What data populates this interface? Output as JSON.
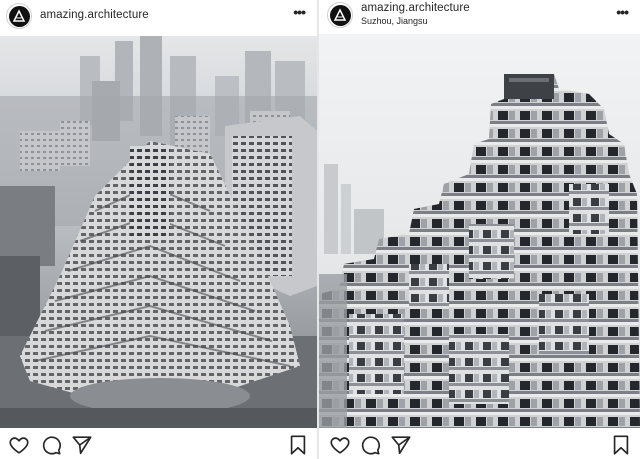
{
  "posts": [
    {
      "username": "amazing.architecture",
      "location": "",
      "more_label": "•••",
      "photo_icon": "aerial-photo-terraced-building",
      "icons": [
        "like-icon",
        "comment-icon",
        "share-icon",
        "bookmark-icon"
      ]
    },
    {
      "username": "amazing.architecture",
      "location": "Suzhou, Jiangsu",
      "more_label": "•••",
      "photo_icon": "closeup-photo-terraced-building",
      "icons": [
        "like-icon",
        "comment-icon",
        "share-icon",
        "bookmark-icon"
      ]
    }
  ],
  "colors": {
    "text": "#262626",
    "avatar": "#111111",
    "divider": "#e6e6e6"
  }
}
